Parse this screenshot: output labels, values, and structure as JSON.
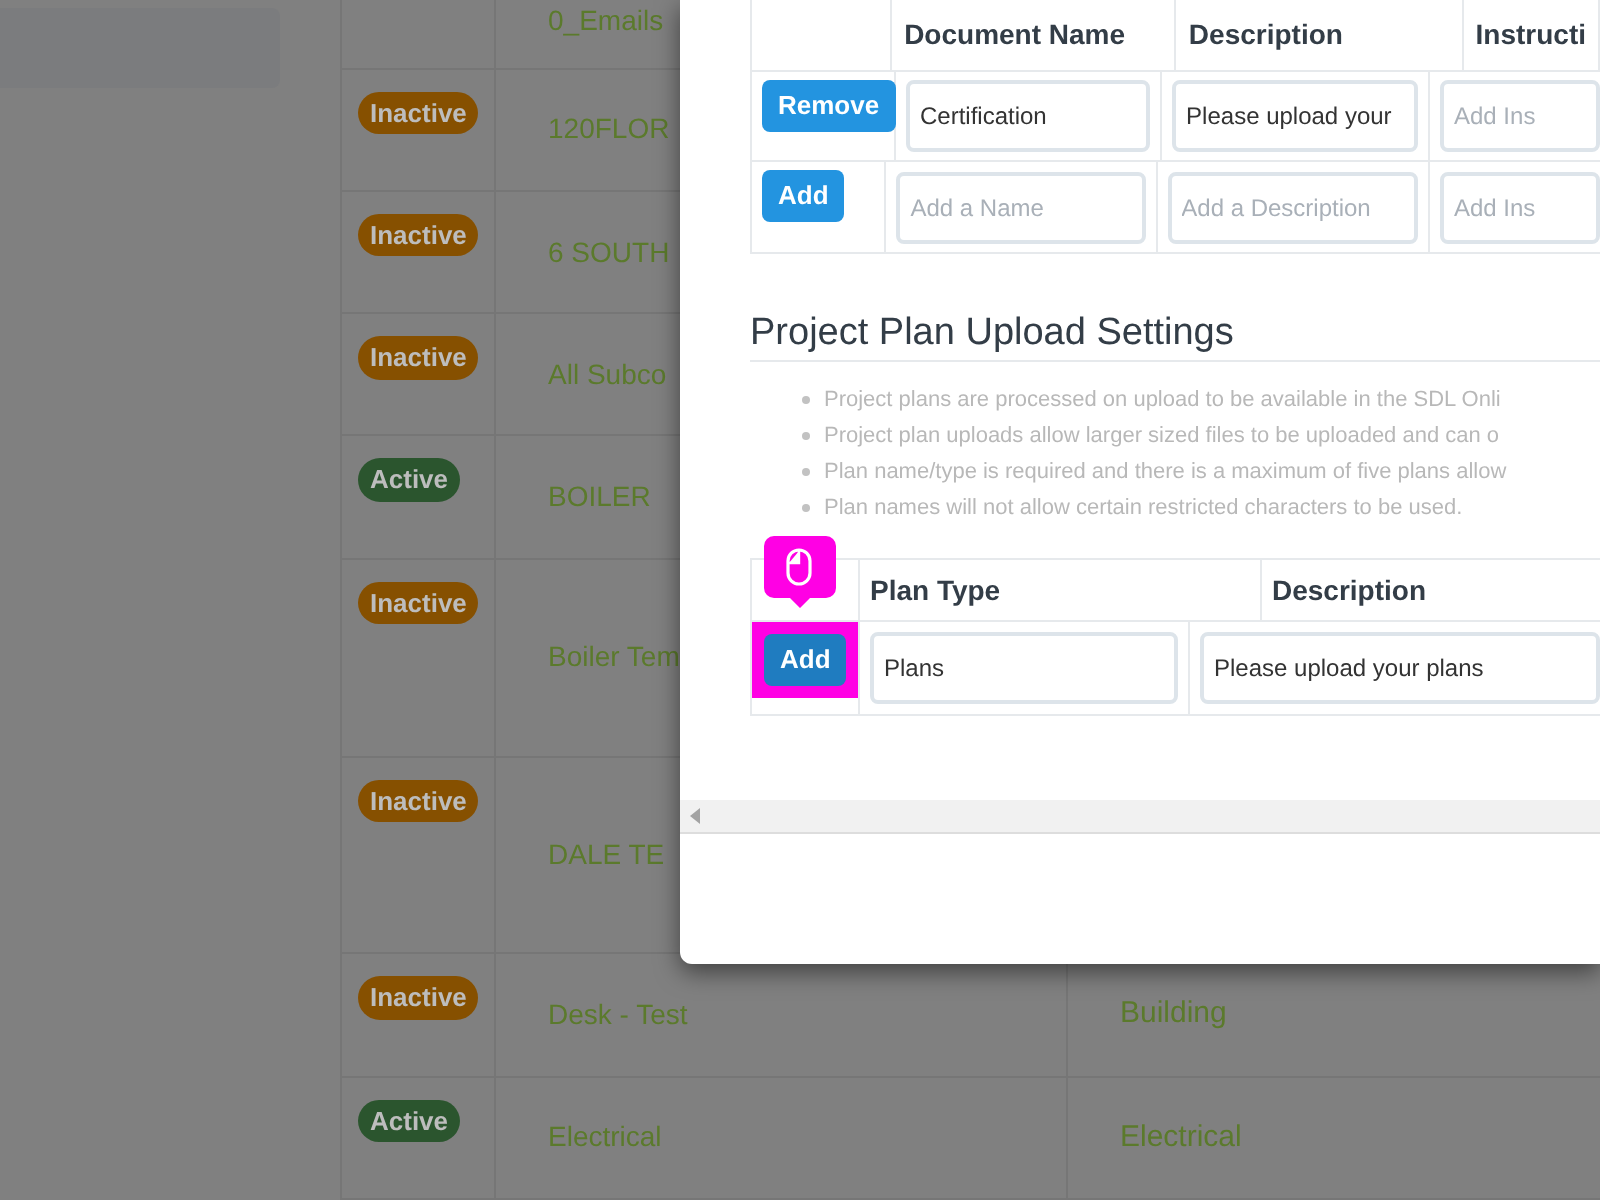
{
  "background_table": {
    "rows": [
      {
        "name": "0_Emails"
      },
      {
        "status": {
          "label": "Inactive",
          "kind": "inactive"
        },
        "name": "120FLOR"
      },
      {
        "status": {
          "label": "Inactive",
          "kind": "inactive"
        },
        "name": "6 SOUTH"
      },
      {
        "status": {
          "label": "Inactive",
          "kind": "inactive"
        },
        "name": "All Subco"
      },
      {
        "status": {
          "label": "Active",
          "kind": "active"
        },
        "name": "BOILER"
      },
      {
        "status": {
          "label": "Inactive",
          "kind": "inactive"
        },
        "name": "Boiler Tem"
      },
      {
        "status": {
          "label": "Inactive",
          "kind": "inactive"
        },
        "name": "DALE TE"
      },
      {
        "status": {
          "label": "Inactive",
          "kind": "inactive"
        },
        "name": "Desk - Test",
        "column_3": "Building"
      },
      {
        "status": {
          "label": "Active",
          "kind": "active"
        },
        "name": "Electrical",
        "column_3": "Electrical"
      }
    ]
  },
  "dialog": {
    "documents_table": {
      "columns": [
        "Document Name",
        "Description",
        "Instructi"
      ],
      "rows": [
        {
          "action": "Remove",
          "name": {
            "value": "Certification"
          },
          "description": {
            "value": "Please upload your"
          },
          "instructions": {
            "placeholder": "Add Ins"
          }
        },
        {
          "action": "Add",
          "name": {
            "placeholder": "Add a Name"
          },
          "description": {
            "placeholder": "Add a Description"
          },
          "instructions": {
            "placeholder": "Add Ins"
          }
        }
      ]
    },
    "plan_section": {
      "title": "Project Plan Upload Settings",
      "notes": [
        "Project plans are processed on upload to be available in the SDL Onli",
        "Project plan uploads allow larger sized files to be uploaded and can o",
        "Plan name/type is required and there is a maximum of five plans allow",
        "Plan names will not allow certain restricted characters to be used."
      ],
      "table": {
        "columns": [
          "Plan Type",
          "Description"
        ],
        "rows": [
          {
            "action": "Add",
            "highlighted": true,
            "plan_type": {
              "value": "Plans"
            },
            "description": {
              "value": "Please upload your plans"
            }
          }
        ]
      }
    }
  }
}
